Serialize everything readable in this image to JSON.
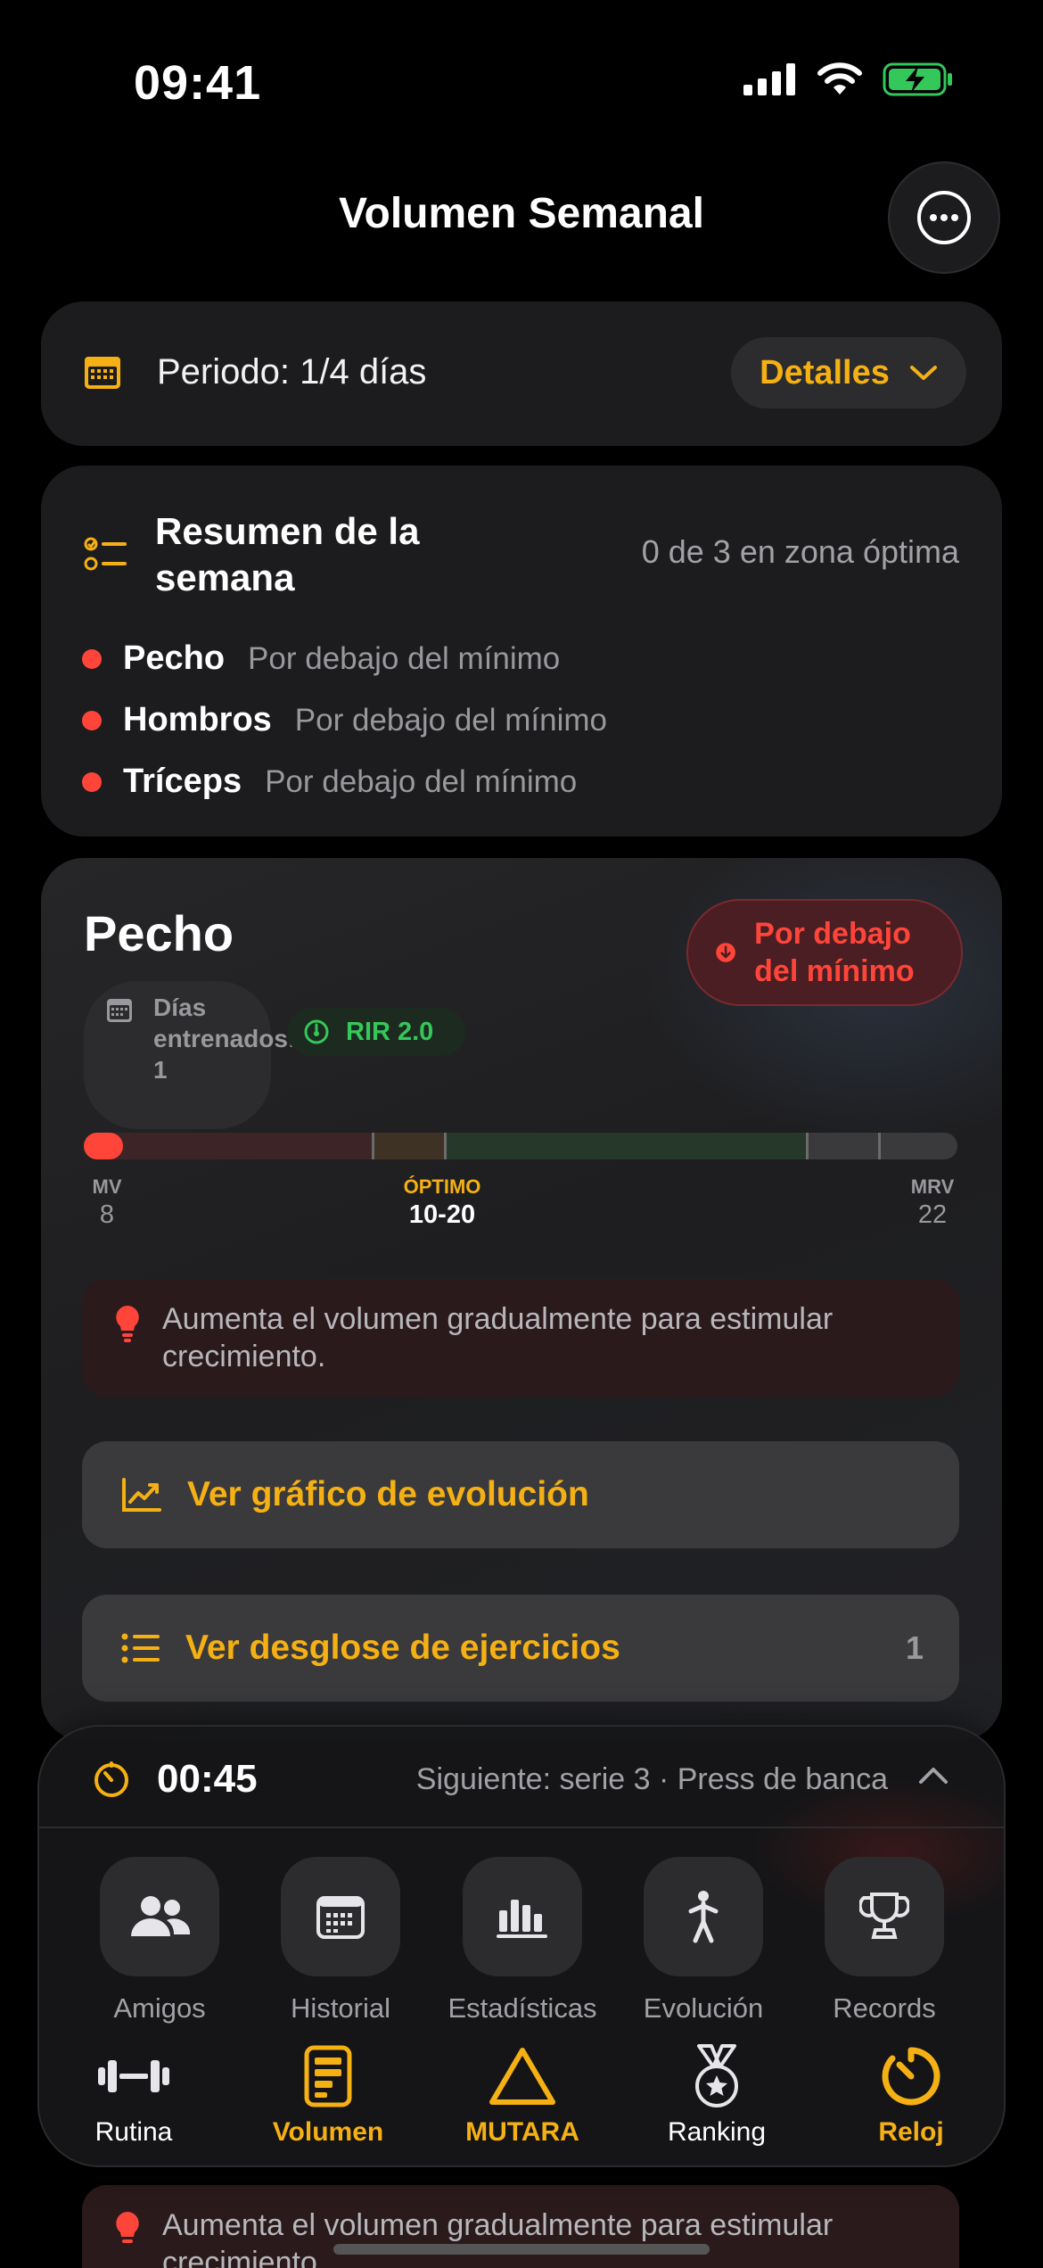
{
  "status_bar": {
    "time": "09:41"
  },
  "header": {
    "title": "Volumen Semanal"
  },
  "period": {
    "label": "Periodo: 1/4 días",
    "details_label": "Detalles"
  },
  "summary": {
    "title": "Resumen de la semana",
    "count_text": "0 de 3 en zona óptima",
    "items": [
      {
        "muscle": "Pecho",
        "status": "Por debajo del mínimo"
      },
      {
        "muscle": "Hombros",
        "status": "Por debajo del mínimo"
      },
      {
        "muscle": "Tríceps",
        "status": "Por debajo del mínimo"
      }
    ]
  },
  "pecho": {
    "title": "Pecho",
    "days_trained": "Días entrenados: 1",
    "rir": "RIR 2.0",
    "status_badge": "Por debajo del mínimo",
    "volume_fraction": 0.045,
    "scale": {
      "mv_label": "MV",
      "mv_value": "8",
      "optimo_label": "ÓPTIMO",
      "optimo_value": "10-20",
      "mrv_label": "MRV",
      "mrv_value": "22"
    },
    "tip": "Aumenta el volumen gradualmente para estimular crecimiento.",
    "evolution_button": "Ver gráfico de evolución",
    "breakdown_button": "Ver desglose de ejercicios",
    "breakdown_count": "1"
  },
  "timer": {
    "value": "00:45",
    "next": "Siguiente: serie 3 · Press de banca"
  },
  "quick_actions": [
    {
      "label": "Amigos",
      "icon": "friends-icon"
    },
    {
      "label": "Historial",
      "icon": "calendar-icon"
    },
    {
      "label": "Estadísticas",
      "icon": "stats-icon"
    },
    {
      "label": "Evolución",
      "icon": "person-icon"
    },
    {
      "label": "Records",
      "icon": "trophy-icon"
    }
  ],
  "tabs": [
    {
      "label": "Rutina",
      "icon": "dumbbell-icon",
      "active": false
    },
    {
      "label": "Volumen",
      "icon": "document-icon",
      "active": true
    },
    {
      "label": "MUTARA",
      "icon": "triangle-icon",
      "active": true
    },
    {
      "label": "Ranking",
      "icon": "medal-icon",
      "active": false
    },
    {
      "label": "Reloj",
      "icon": "timer-icon",
      "active": true
    }
  ],
  "colors": {
    "accent": "#f5b014",
    "danger": "#ff453a",
    "success": "#34c759"
  }
}
